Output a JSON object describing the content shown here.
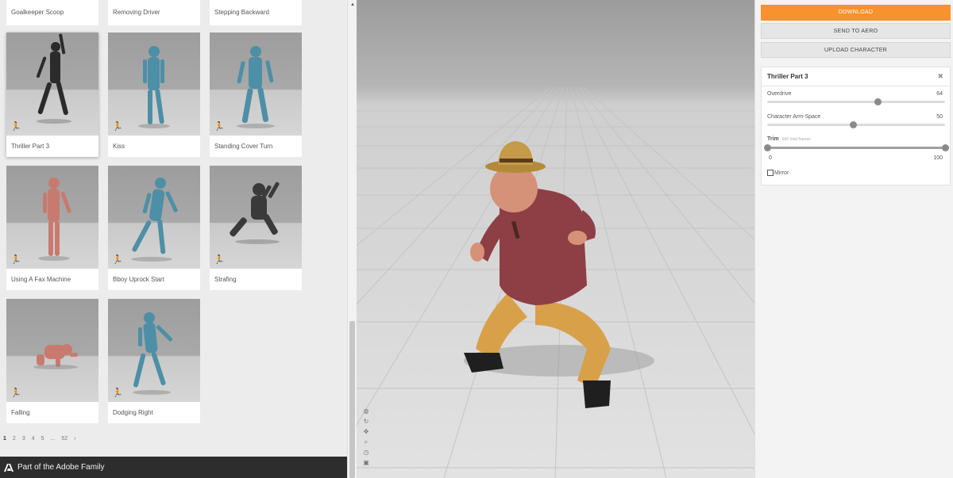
{
  "library": {
    "top_row": [
      "Goalkeeper Scoop",
      "Removing Driver",
      "Stepping Backward"
    ],
    "cards": [
      {
        "label": "Thriller Part 3",
        "selected": true,
        "tint": "#2b2b2b"
      },
      {
        "label": "Kiss",
        "selected": false,
        "tint": "#4d8fa6"
      },
      {
        "label": "Standing Cover Turn",
        "selected": false,
        "tint": "#4d8fa6"
      },
      {
        "label": "Using A Fax Machine",
        "selected": false,
        "tint": "#c97a6f"
      },
      {
        "label": "Bboy Uprock Start",
        "selected": false,
        "tint": "#4d8fa6"
      },
      {
        "label": "Strafing",
        "selected": false,
        "tint": "#3a3a3a"
      },
      {
        "label": "Falling",
        "selected": false,
        "tint": "#c97a6f"
      },
      {
        "label": "Dodging Right",
        "selected": false,
        "tint": "#4d8fa6"
      }
    ],
    "run_icon": "running-figure-icon",
    "pagination": [
      "1",
      "2",
      "3",
      "4",
      "5",
      "...",
      "52",
      "›"
    ],
    "active_page": "1",
    "scroll_up_icon": "▲"
  },
  "footer": {
    "logo_icon": "adobe-logo-icon",
    "text": "Part of the Adobe Family"
  },
  "viewport": {
    "character": "old-man-in-hat-with-cigar",
    "tools": [
      "globe-icon",
      "rotate-icon",
      "move-icon",
      "zoom-icon",
      "clock-icon",
      "camera-icon"
    ]
  },
  "actions": {
    "download": "DOWNLOAD",
    "send_to_aero": "SEND TO AERO",
    "upload_character": "UPLOAD CHARACTER"
  },
  "settings": {
    "title": "Thriller Part 3",
    "close_icon": "✖",
    "overdrive_label": "Overdrive",
    "overdrive_value": "64",
    "overdrive_fraction": 0.62,
    "arm_space_label": "Character Arm-Space",
    "arm_space_value": "50",
    "arm_space_fraction": 0.48,
    "trim_label": "Trim",
    "trim_total": "600 total frames",
    "trim_min": "0",
    "trim_max": "100",
    "trim_start_fraction": 0.0,
    "trim_end_fraction": 1.0,
    "mirror_label": "Mirror",
    "mirror_checked": false
  },
  "colors": {
    "accent": "#f7922d",
    "footer_bg": "#2d2d2d"
  }
}
